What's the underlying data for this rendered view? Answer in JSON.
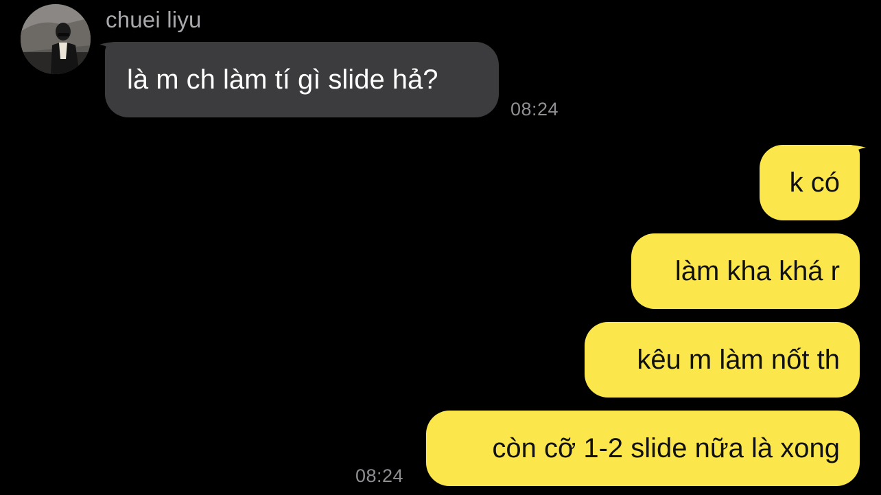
{
  "conversation": {
    "sender_name": "chuei liyu",
    "incoming": [
      {
        "text": "là m ch làm tí gì slide hả?",
        "time": "08:24"
      }
    ],
    "outgoing": [
      {
        "text": "k có"
      },
      {
        "text": "làm kha khá r"
      },
      {
        "text": "kêu m làm nốt th"
      },
      {
        "text": "còn cỡ 1-2 slide nữa là xong"
      }
    ],
    "outgoing_time": "08:24"
  },
  "colors": {
    "background": "#000000",
    "incoming_bubble": "#3c3c3e",
    "outgoing_bubble": "#fbe74c",
    "timestamp": "#8e8e93"
  }
}
